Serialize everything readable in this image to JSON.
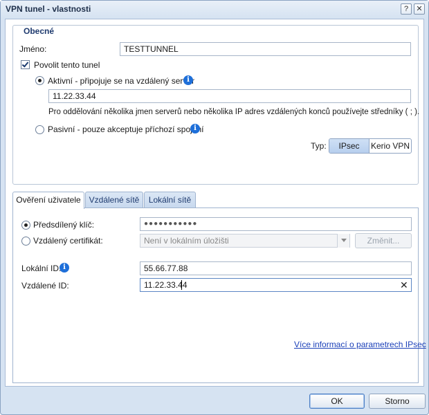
{
  "window": {
    "title": "VPN tunel - vlastnosti",
    "help_label": "?",
    "close_label": "✕"
  },
  "general": {
    "legend": "Obecné",
    "name_label": "Jméno:",
    "name_value": "TESTTUNNEL",
    "enable_label": "Povolit tento tunel",
    "enable_checked": true,
    "active_label": "Aktivní - připojuje se na vzdálený server",
    "active_selected": true,
    "server_value": "11.22.33.44",
    "server_hint": "Pro oddělování několika jmen serverů nebo několika IP adres vzdálených konců používejte středníky ( ; ).",
    "passive_label": "Pasivní - pouze akceptuje příchozí spojení",
    "type_label": "Typ:",
    "type_options": [
      "IPsec",
      "Kerio VPN"
    ],
    "type_selected": "IPsec",
    "info_glyph": "i"
  },
  "tabs": [
    {
      "label": "Ověření uživatele",
      "active": true
    },
    {
      "label": "Vzdálené sítě",
      "active": false
    },
    {
      "label": "Lokální sítě",
      "active": false
    }
  ],
  "auth": {
    "psk_label": "Předsdílený klíč:",
    "psk_selected": true,
    "psk_value": "●●●●●●●●●●●",
    "cert_label": "Vzdálený certifikát:",
    "cert_value": "Není v lokálním úložišti",
    "change_label": "Změnit...",
    "local_id_label": "Lokální ID:",
    "local_id_value": "55.66.77.88",
    "remote_id_label": "Vzdálené ID:",
    "remote_id_value": "11.22.33.44",
    "clear_glyph": "✕",
    "more_info_link": "Více informací o parametrech IPsec"
  },
  "footer": {
    "ok_label": "OK",
    "cancel_label": "Storno"
  },
  "colors": {
    "frame": "#d6e3f2",
    "accent": "#1e6fd9",
    "link": "#1a3fb8"
  }
}
